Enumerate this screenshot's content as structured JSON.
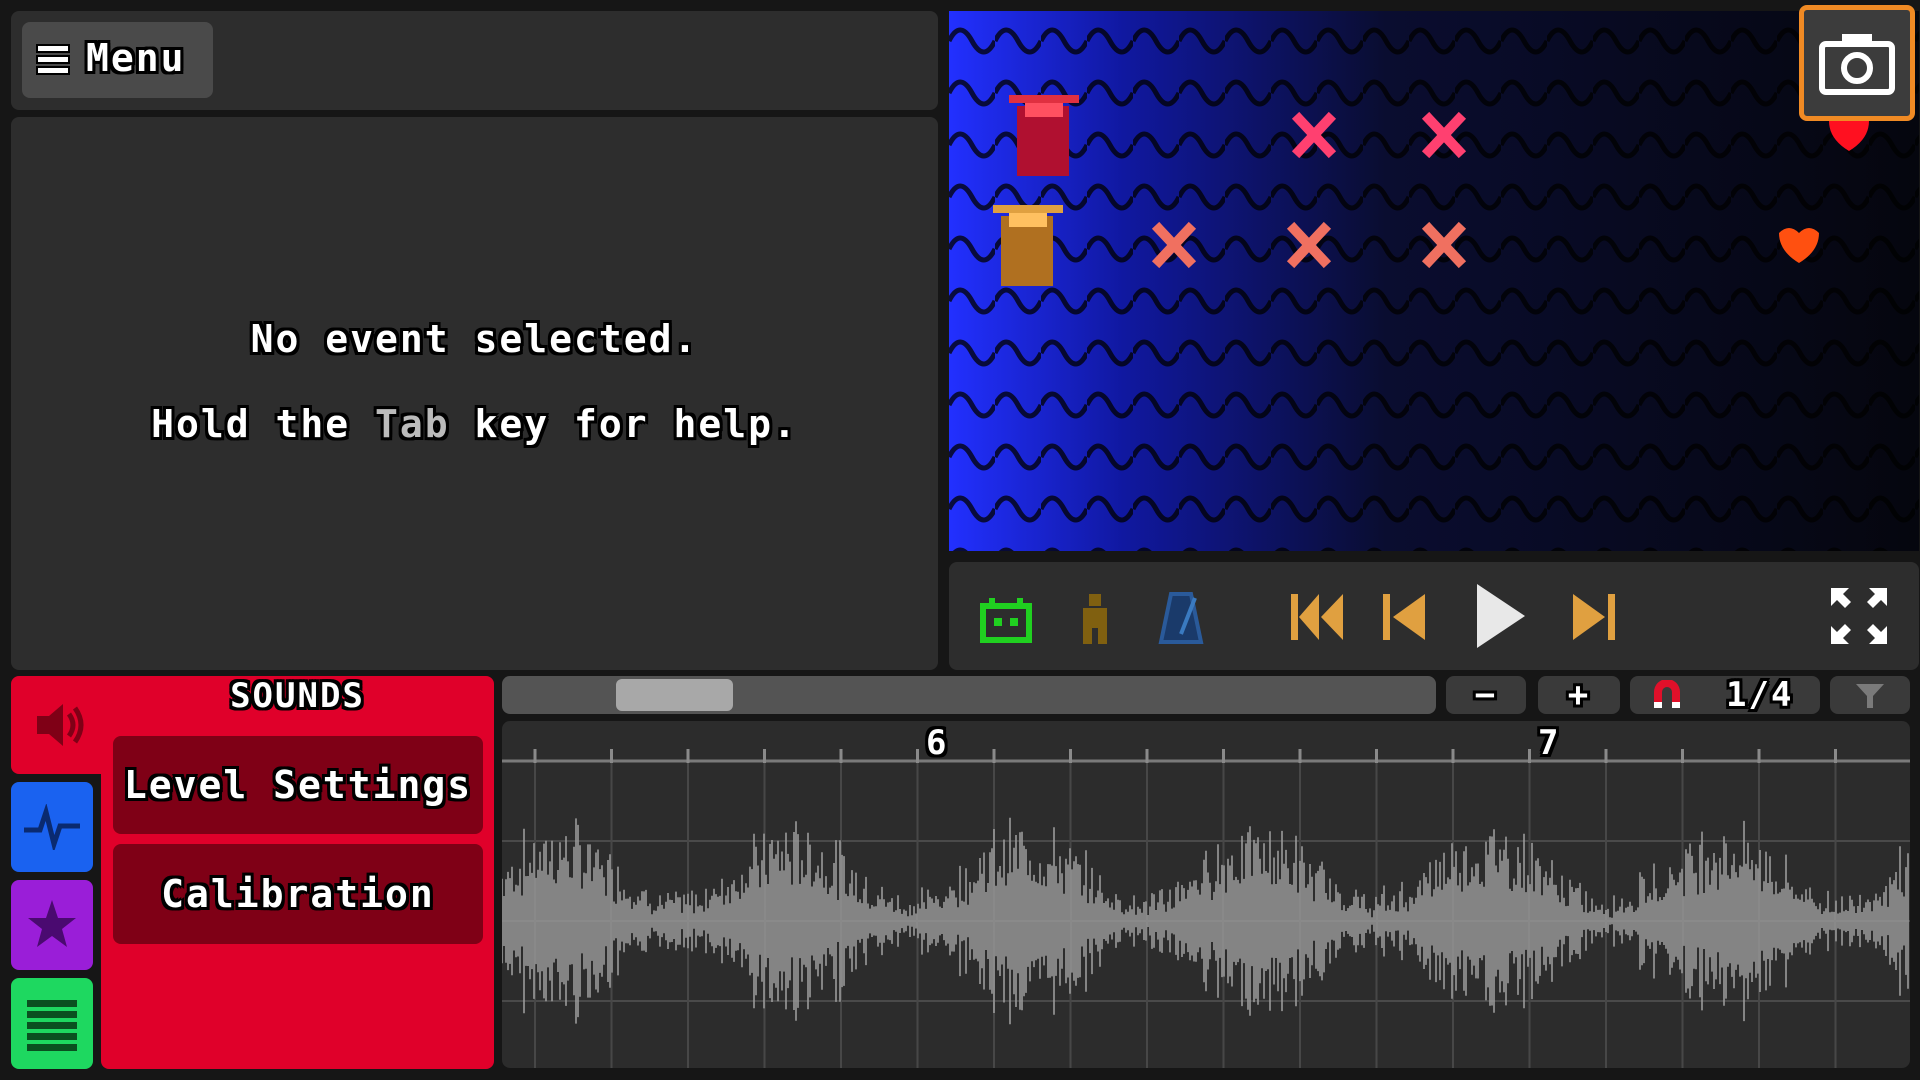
{
  "menu": {
    "label": "Menu"
  },
  "inspector": {
    "message": "No event selected.",
    "help_prefix": "Hold the ",
    "help_key": "Tab",
    "help_suffix": " key for help."
  },
  "preview": {
    "rows": [
      {
        "character": "samurai-red",
        "row_color": "#ff2050"
      },
      {
        "character": "samurai-gold",
        "row_color": "#f0c020"
      }
    ]
  },
  "transport": {
    "buttons": [
      "robot-icon",
      "character-icon",
      "metronome-icon",
      "skip-to-start-icon",
      "previous-icon",
      "play-icon",
      "skip-to-end-icon",
      "fullscreen-icon"
    ]
  },
  "tabs": {
    "sounds": {
      "title": "SOUNDS",
      "color": "#e0002a"
    },
    "rows": {
      "color": "#1a62f0"
    },
    "vfx": {
      "color": "#9a1ed8"
    },
    "rooms": {
      "color": "#1ed860"
    }
  },
  "sound_panel": {
    "level_settings": "Level Settings",
    "calibration": "Calibration"
  },
  "timeline": {
    "zoom_out": "−",
    "zoom_in": "+",
    "snap": "1/4",
    "bar_labels": [
      "6",
      "7"
    ]
  },
  "colors": {
    "accent_orange": "#f08a24",
    "waveform": "#9a9a9a"
  }
}
